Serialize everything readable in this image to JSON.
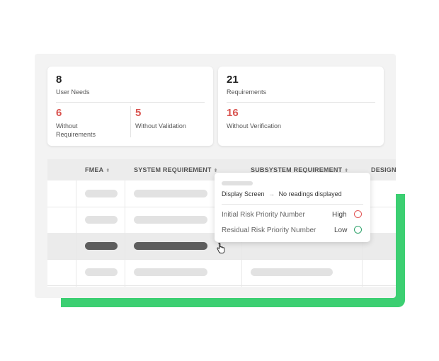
{
  "summary": {
    "user_needs": {
      "count": "8",
      "label": "User Needs"
    },
    "without_requirements": {
      "count": "6",
      "label_line1": "Without",
      "label_line2": "Requirements"
    },
    "without_validation": {
      "count": "5",
      "label": "Without Validation"
    },
    "requirements": {
      "count": "21",
      "label": "Requirements"
    },
    "without_verification": {
      "count": "16",
      "label": "Without Verification"
    }
  },
  "table": {
    "columns": [
      {
        "label": "FMEA"
      },
      {
        "label": "SYSTEM REQUIREMENT"
      },
      {
        "label": "SUBSYSTEM REQUIREMENT"
      },
      {
        "label": "DESIGN"
      }
    ],
    "sort_glyph": "⬍"
  },
  "tooltip": {
    "display_screen": "Display Screen",
    "arrow": "→",
    "readings": "No readings displayed",
    "initial_label": "Initial Risk Priority Number",
    "initial_value": "High",
    "residual_label": "Residual Risk Priority Number",
    "residual_value": "Low"
  },
  "colors": {
    "accent_green": "#3ccf72",
    "alert_red": "#d9534f",
    "high_circle": "#e25555",
    "low_circle": "#2fa36b"
  }
}
